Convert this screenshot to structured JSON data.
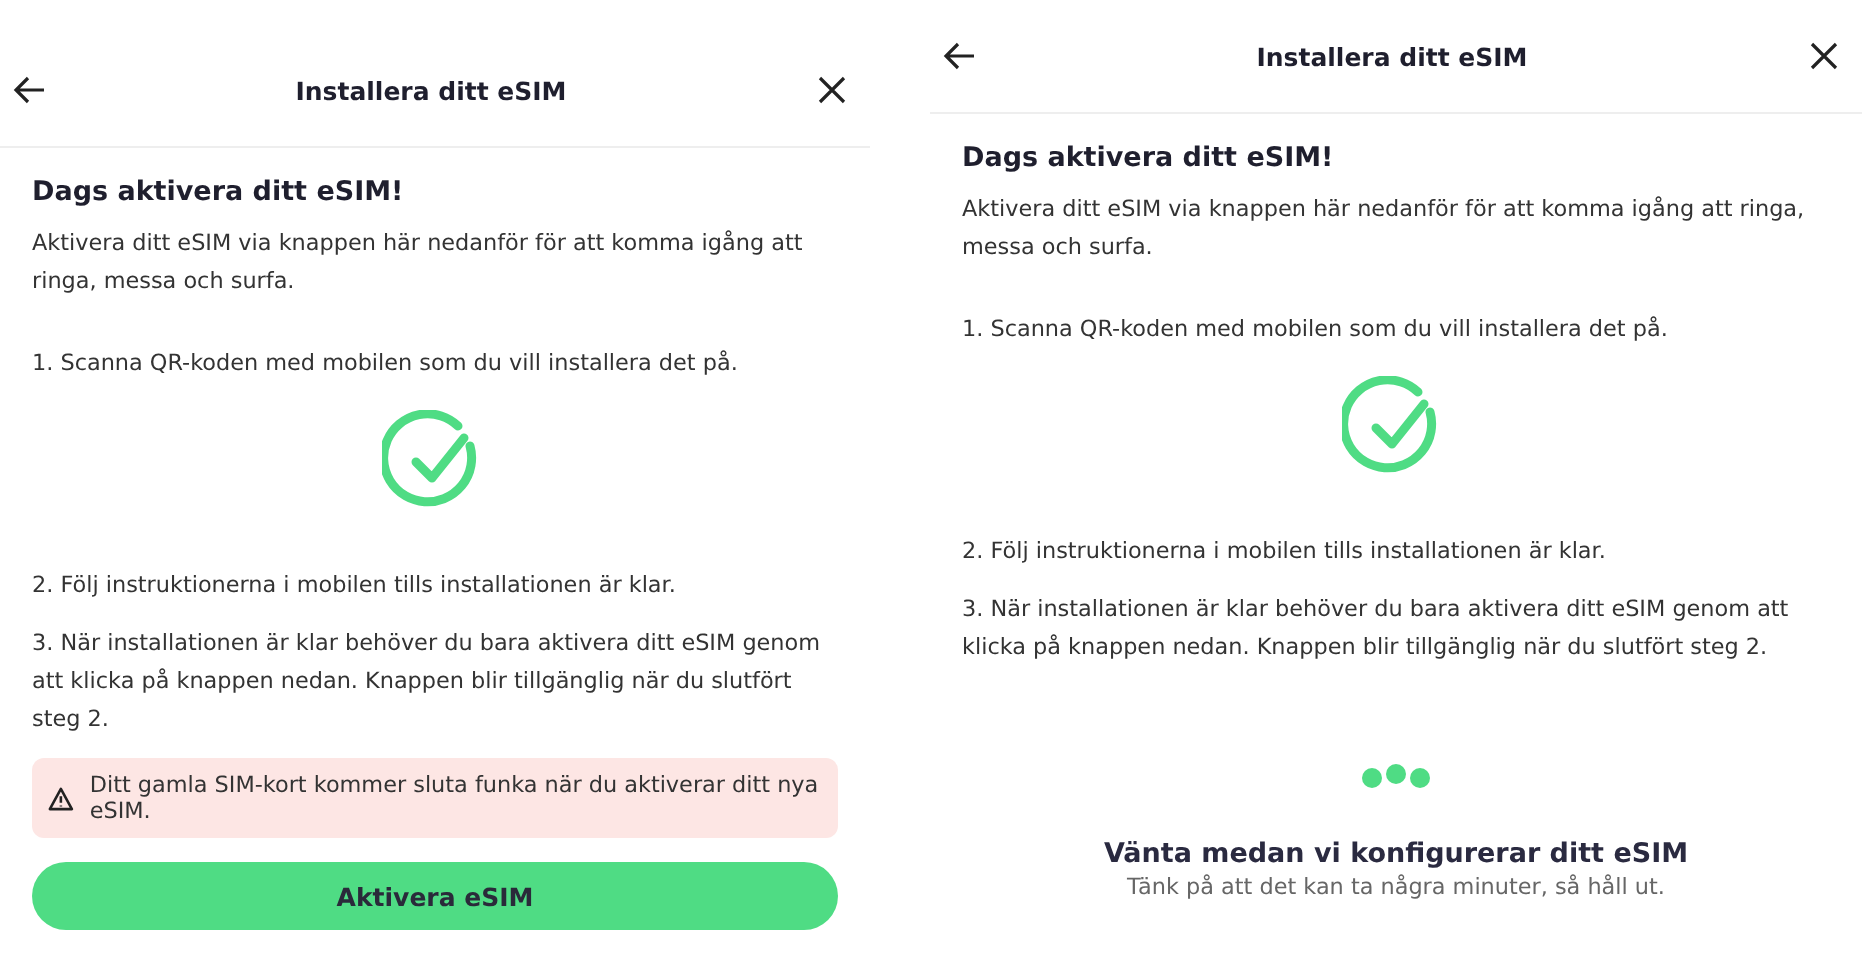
{
  "panels": [
    {
      "kind": "activate",
      "title": "Installera ditt eSIM",
      "heading": "Dags aktivera ditt eSIM!",
      "intro": "Aktivera ditt eSIM via knappen här nedanför för att komma igång att ringa, messa och surfa.",
      "steps": [
        "1. Scanna QR-koden med mobilen som du vill installera det på.",
        "2. Följ instruktionerna i mobilen tills installationen är klar.",
        "3. När installationen är klar behöver du bara aktivera ditt eSIM genom att klicka på knappen nedan. Knappen blir tillgänglig när du slutfört steg 2."
      ],
      "warning": "Ditt gamla SIM-kort kommer sluta funka när du aktiverar ditt nya eSIM.",
      "button": "Aktivera eSIM"
    },
    {
      "kind": "waiting",
      "title": "Installera ditt eSIM",
      "heading": "Dags aktivera ditt eSIM!",
      "intro": "Aktivera ditt eSIM via knappen här nedanför för att komma igång att ringa, messa och surfa.",
      "steps": [
        "1. Scanna QR-koden med mobilen som du vill installera det på.",
        "2. Följ instruktionerna i mobilen tills installationen är klar.",
        "3. När installationen är klar behöver du bara aktivera ditt eSIM genom att klicka på knappen nedan. Knappen blir tillgänglig när du slutfört steg 2."
      ],
      "wait_title": "Vänta medan vi konfigurerar ditt eSIM",
      "wait_subtitle": "Tänk på att det kan ta några minuter, så håll ut."
    }
  ]
}
